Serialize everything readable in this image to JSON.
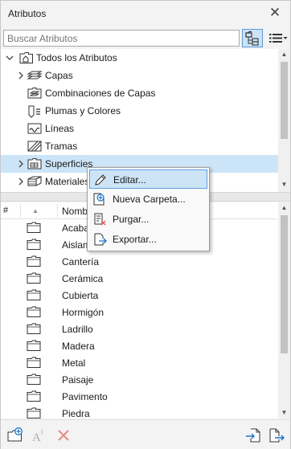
{
  "panel": {
    "title": "Atributos",
    "close_glyph": "✕"
  },
  "search": {
    "placeholder": "Buscar Atributos",
    "value": ""
  },
  "view_buttons": {
    "tree_icon": "tree-view-icon",
    "list_icon": "list-view-icon"
  },
  "tree": {
    "root": {
      "label": "Todos los Atributos",
      "icon": "attributes-root-icon",
      "expanded": true
    },
    "items": [
      {
        "label": "Capas",
        "icon": "layers-icon",
        "expandable": true
      },
      {
        "label": "Combinaciones de Capas",
        "icon": "layer-combinations-icon",
        "expandable": false
      },
      {
        "label": "Plumas y Colores",
        "icon": "pens-colors-icon",
        "expandable": false
      },
      {
        "label": "Líneas",
        "icon": "line-types-icon",
        "expandable": false
      },
      {
        "label": "Tramas",
        "icon": "fills-icon",
        "expandable": false
      },
      {
        "label": "Superficies",
        "icon": "surfaces-icon",
        "expandable": true,
        "selected": true
      },
      {
        "label": "Materiales",
        "icon": "building-materials-icon",
        "expandable": true
      }
    ]
  },
  "list": {
    "columns": {
      "index": "#",
      "name": "Nombre"
    },
    "rows": [
      {
        "name": "Acabado"
      },
      {
        "name": "Aislamiento"
      },
      {
        "name": "Cantería"
      },
      {
        "name": "Cerámica"
      },
      {
        "name": "Cubierta"
      },
      {
        "name": "Hormigón"
      },
      {
        "name": "Ladrillo"
      },
      {
        "name": "Madera"
      },
      {
        "name": "Metal"
      },
      {
        "name": "Paisaje"
      },
      {
        "name": "Pavimento"
      },
      {
        "name": "Piedra"
      }
    ]
  },
  "context_menu": {
    "items": [
      {
        "label": "Editar...",
        "icon": "pencil-icon",
        "hovered": true
      },
      {
        "label": "Nueva Carpeta...",
        "icon": "new-folder-icon"
      },
      {
        "label": "Purgar...",
        "icon": "purge-icon"
      },
      {
        "label": "Exportar...",
        "icon": "export-icon"
      }
    ]
  },
  "bottom_toolbar": {
    "left": [
      "new-folder-icon",
      "rename-icon",
      "delete-icon"
    ],
    "right": [
      "import-icon",
      "export-icon"
    ]
  },
  "colors": {
    "selection": "#cce4f7",
    "accent": "#1a73c9",
    "delete": "#e05a4e"
  }
}
